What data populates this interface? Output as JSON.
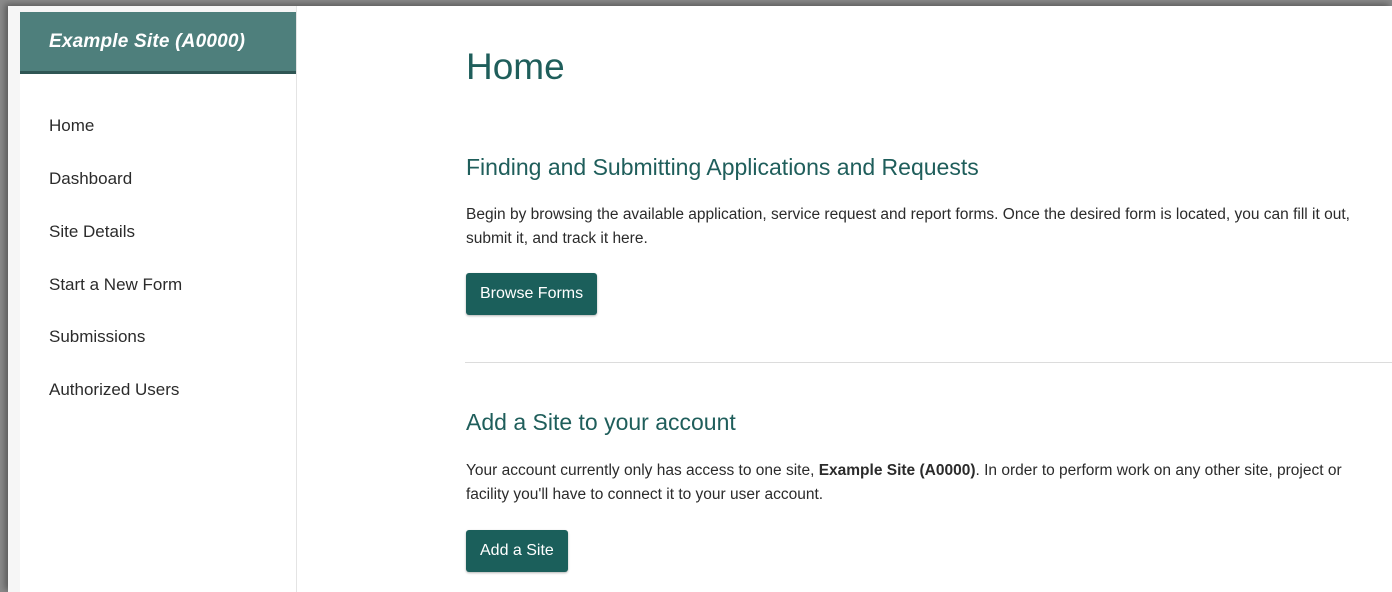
{
  "sidebar": {
    "site_name": "Example Site (A0000)",
    "items": [
      {
        "label": "Home"
      },
      {
        "label": "Dashboard"
      },
      {
        "label": "Site Details"
      },
      {
        "label": "Start a New Form"
      },
      {
        "label": "Submissions"
      },
      {
        "label": "Authorized Users"
      }
    ]
  },
  "main": {
    "title": "Home",
    "sections": [
      {
        "heading": "Finding and Submitting Applications and Requests",
        "text": "Begin by browsing the available application, service request and report forms. Once the desired form is located, you can fill it out, submit it, and track it here.",
        "button_label": "Browse Forms"
      },
      {
        "heading": "Add a Site to your account",
        "text_before": "Your account currently only has access to one site, ",
        "text_bold": "Example Site (A0000)",
        "text_after": ". In order to perform work on any other site, project or facility you'll have to connect it to your user account.",
        "button_label": "Add a Site"
      }
    ]
  },
  "colors": {
    "accent": "#1b5f5b",
    "header_bg": "#4e7f7c",
    "heading_text": "#1f5e5b"
  }
}
